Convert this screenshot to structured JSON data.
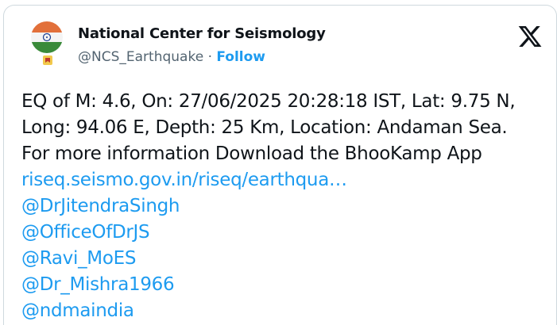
{
  "account": {
    "display_name": "National Center for Seismology",
    "handle": "@NCS_Earthquake",
    "separator": "·",
    "follow_label": "Follow"
  },
  "icons": {
    "avatar": "india-flag-avatar-icon",
    "badge": "government-badge-icon",
    "platform": "x-logo-icon"
  },
  "tweet": {
    "lines": [
      "EQ of M: 4.6, On: 27/06/2025 20:28:18 IST, Lat: 9.75 N,",
      "Long: 94.06 E, Depth: 25 Km, Location: Andaman Sea.",
      "For more information Download the BhooKamp App"
    ],
    "link": "riseq.seismo.gov.in/riseq/earthqua…",
    "mentions": [
      "@DrJitendraSingh",
      "@OfficeOfDrJS",
      "@Ravi_MoES",
      "@Dr_Mishra1966",
      "@ndmaindia"
    ]
  },
  "colors": {
    "text": "#0f1419",
    "secondary": "#536471",
    "link": "#1d9bf0",
    "border": "#cfd9de"
  }
}
